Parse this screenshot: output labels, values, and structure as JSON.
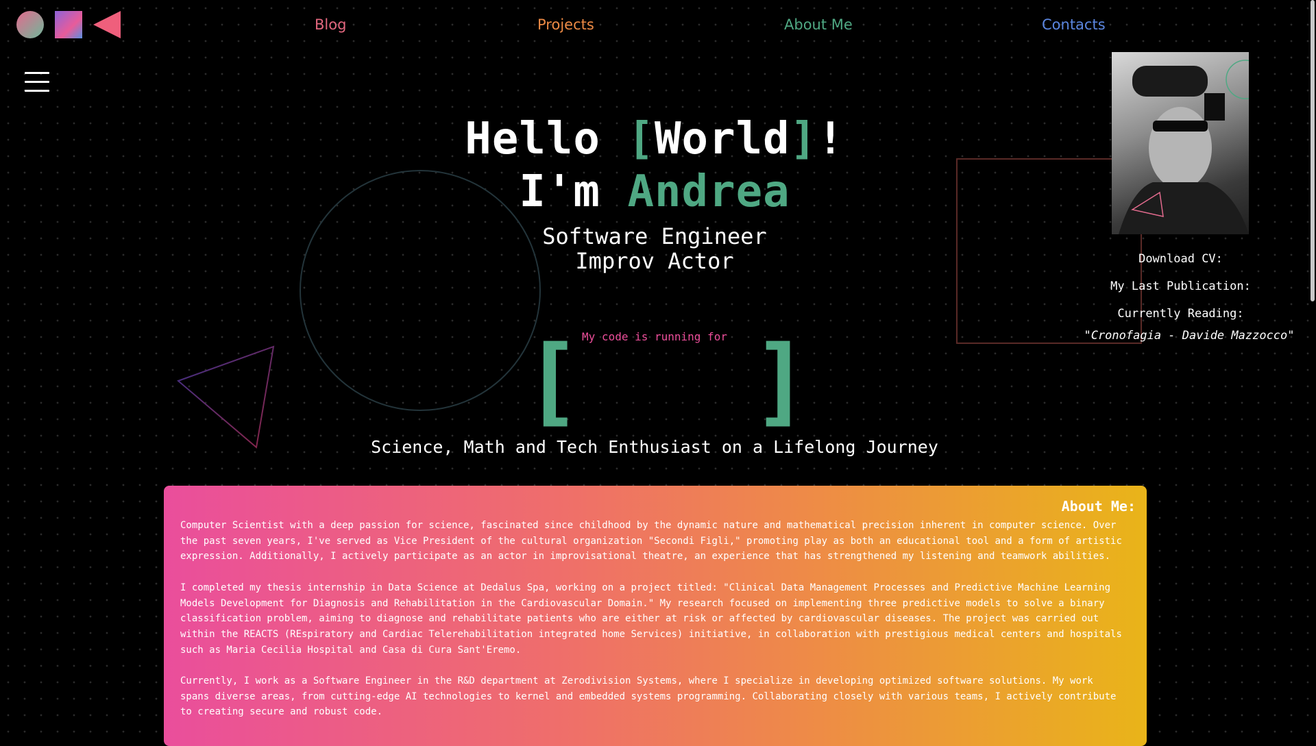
{
  "logo": {
    "icons": [
      "circle-logo-icon",
      "square-logo-icon",
      "triangle-logo-icon"
    ]
  },
  "nav": {
    "items": [
      {
        "label": "Blog",
        "color": "#e2677e"
      },
      {
        "label": "Projects",
        "color": "#ec8a45"
      },
      {
        "label": "About Me",
        "color": "#4fa883"
      },
      {
        "label": "Contacts",
        "color": "#5b86e0"
      }
    ]
  },
  "hero": {
    "hello_prefix": "Hello ",
    "bracket_open": "[",
    "world": "World",
    "bracket_close": "]",
    "hello_suffix": "!",
    "im_prefix": "I'm ",
    "name": "Andrea",
    "roles": [
      "Software Engineer",
      "Improv Actor"
    ],
    "running_label": "My code is running for",
    "counter_open": "[",
    "counter_close": "]",
    "tagline": "Science, Math and Tech Enthusiast on a Lifelong Journey"
  },
  "sidebar_right": {
    "download_cv": "Download CV:",
    "last_publication": "My Last Publication:",
    "currently_reading": "Currently Reading:",
    "book": "\"Cronofagia - Davide Mazzocco\""
  },
  "about": {
    "title": "About Me:",
    "paragraphs": [
      "Computer Scientist with a deep passion for science, fascinated since childhood by the dynamic nature and mathematical precision inherent in computer science. Over the past seven years, I've served as Vice President of the cultural organization \"Secondi Figli,\" promoting play as both an educational tool and a form of artistic expression. Additionally, I actively participate as an actor in improvisational theatre, an experience that has strengthened my listening and teamwork abilities.",
      "I completed my thesis internship in Data Science at Dedalus Spa, working on a project titled: \"Clinical Data Management Processes and Predictive Machine Learning Models Development for Diagnosis and Rehabilitation in the Cardiovascular Domain.\" My research focused on implementing three predictive models to solve a binary classification problem, aiming to diagnose and rehabilitate patients who are either at risk or affected by cardiovascular diseases. The project was carried out within the REACTS (REspiratory and Cardiac Telerehabilitation integrated home Services) initiative, in collaboration with prestigious medical centers and hospitals such as Maria Cecilia Hospital and Casa di Cura Sant'Eremo.",
      "Currently, I work as a Software Engineer in the R&D department at Zerodivision Systems, where I specialize in developing optimized software solutions. My work spans diverse areas, from cutting-edge AI technologies to kernel and embedded systems programming. Collaborating closely with various teams, I actively contribute to creating secure and robust code."
    ]
  }
}
